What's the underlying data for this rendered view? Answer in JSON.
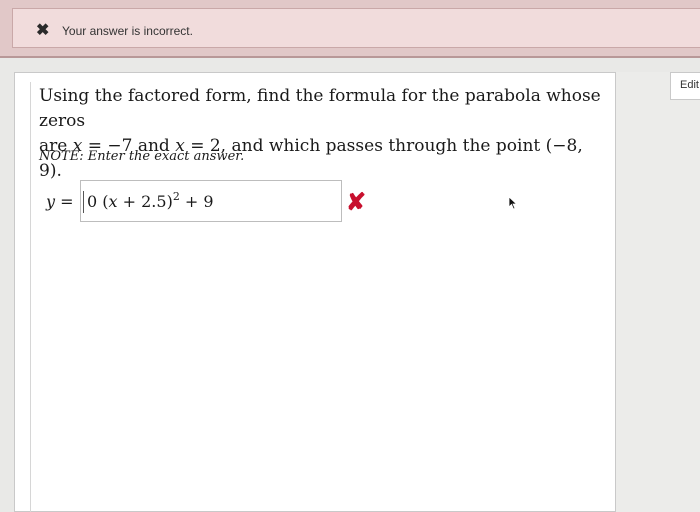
{
  "alert": {
    "icon": "close-x-icon",
    "message": "Your answer is incorrect."
  },
  "edit_button": {
    "label": "Edit"
  },
  "question": {
    "line1": "Using the factored form, find the formula for the parabola whose zeros",
    "line2_prefix": "are ",
    "zero1_var": "x",
    "zero1_eq": " = −7 and ",
    "zero2_var": "x",
    "zero2_eq": " = 2, and which passes through the point (−8, 9).",
    "note": "NOTE: Enter the exact answer."
  },
  "answer": {
    "label_var": "y",
    "label_eq": " =",
    "value_part1": "0 (",
    "value_var": "x",
    "value_part2": " + 2.5)",
    "value_exp": "2",
    "value_part3": " + 9",
    "status_icon": "incorrect-x-icon",
    "status_color": "#c8102e"
  }
}
